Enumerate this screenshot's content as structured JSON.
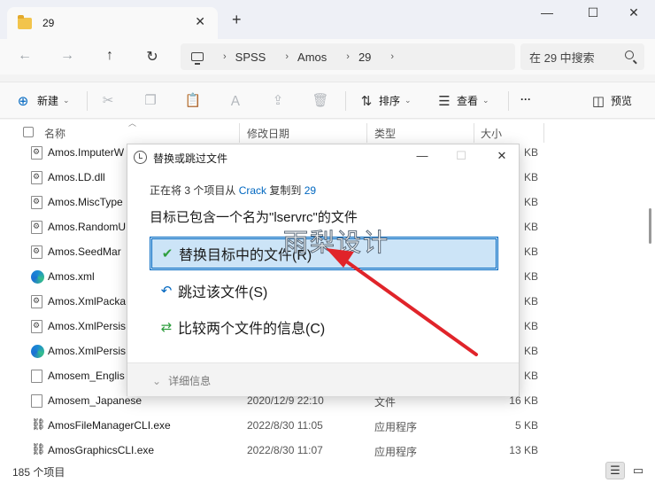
{
  "tab": {
    "title": "29",
    "close": "✕",
    "new_tab": "+"
  },
  "window_controls": {
    "minimize": "—",
    "maximize": "☐",
    "close": "✕"
  },
  "nav": {
    "back": "←",
    "forward": "→",
    "up": "↑",
    "refresh": "↻"
  },
  "address": {
    "breadcrumbs": [
      "SPSS",
      "Amos",
      "29"
    ],
    "sep": "›"
  },
  "search": {
    "placeholder": "在 29 中搜索"
  },
  "toolbar": {
    "new_label": "新建",
    "sort_label": "排序",
    "view_label": "查看",
    "more_label": "···",
    "preview_label": "预览"
  },
  "columns": {
    "name": "名称",
    "date": "修改日期",
    "type": "类型",
    "size": "大小"
  },
  "files": [
    {
      "name": "Amos.ImputerW",
      "date": "",
      "type": "",
      "size": "KB",
      "icon": "gear-doc"
    },
    {
      "name": "Amos.LD.dll",
      "date": "",
      "type": "",
      "size": "KB",
      "icon": "gear-doc"
    },
    {
      "name": "Amos.MiscType",
      "date": "",
      "type": "",
      "size": "KB",
      "icon": "gear-doc"
    },
    {
      "name": "Amos.RandomU",
      "date": "",
      "type": "",
      "size": "KB",
      "icon": "gear-doc"
    },
    {
      "name": "Amos.SeedMar",
      "date": "",
      "type": "",
      "size": "KB",
      "icon": "gear-doc"
    },
    {
      "name": "Amos.xml",
      "date": "",
      "type": "",
      "size": "KB",
      "icon": "edge"
    },
    {
      "name": "Amos.XmlPacka",
      "date": "",
      "type": "",
      "size": "KB",
      "icon": "gear-doc"
    },
    {
      "name": "Amos.XmlPersis",
      "date": "",
      "type": "",
      "size": "KB",
      "icon": "gear-doc"
    },
    {
      "name": "Amos.XmlPersis",
      "date": "",
      "type": "",
      "size": "KB",
      "icon": "edge"
    },
    {
      "name": "Amosem_Englis",
      "date": "",
      "type": "",
      "size": "KB",
      "icon": "doc"
    },
    {
      "name": "Amosem_Japanese",
      "date": "2020/12/9 22:10",
      "type": "文件",
      "size": "16 KB",
      "icon": "doc"
    },
    {
      "name": "AmosFileManagerCLI.exe",
      "date": "2022/8/30 11:05",
      "type": "应用程序",
      "size": "5 KB",
      "icon": "exe"
    },
    {
      "name": "AmosGraphicsCLI.exe",
      "date": "2022/8/30 11:07",
      "type": "应用程序",
      "size": "13 KB",
      "icon": "exe"
    }
  ],
  "status": {
    "count_text": "185 个项目"
  },
  "dialog": {
    "title": "替换或跳过文件",
    "line1_prefix": "正在将 3 个项目从 ",
    "line1_src": "Crack",
    "line1_mid": " 复制到 ",
    "line1_dst": "29",
    "line2": "目标已包含一个名为\"lservrc\"的文件",
    "option_replace": "替换目标中的文件(R)",
    "option_skip": "跳过该文件(S)",
    "option_compare": "比较两个文件的信息(C)",
    "details": "详细信息"
  },
  "watermark": "雨梨设计",
  "colors": {
    "accent": "#0067c0",
    "selected_bg": "#cce4f7",
    "arrow": "#e0242a"
  }
}
